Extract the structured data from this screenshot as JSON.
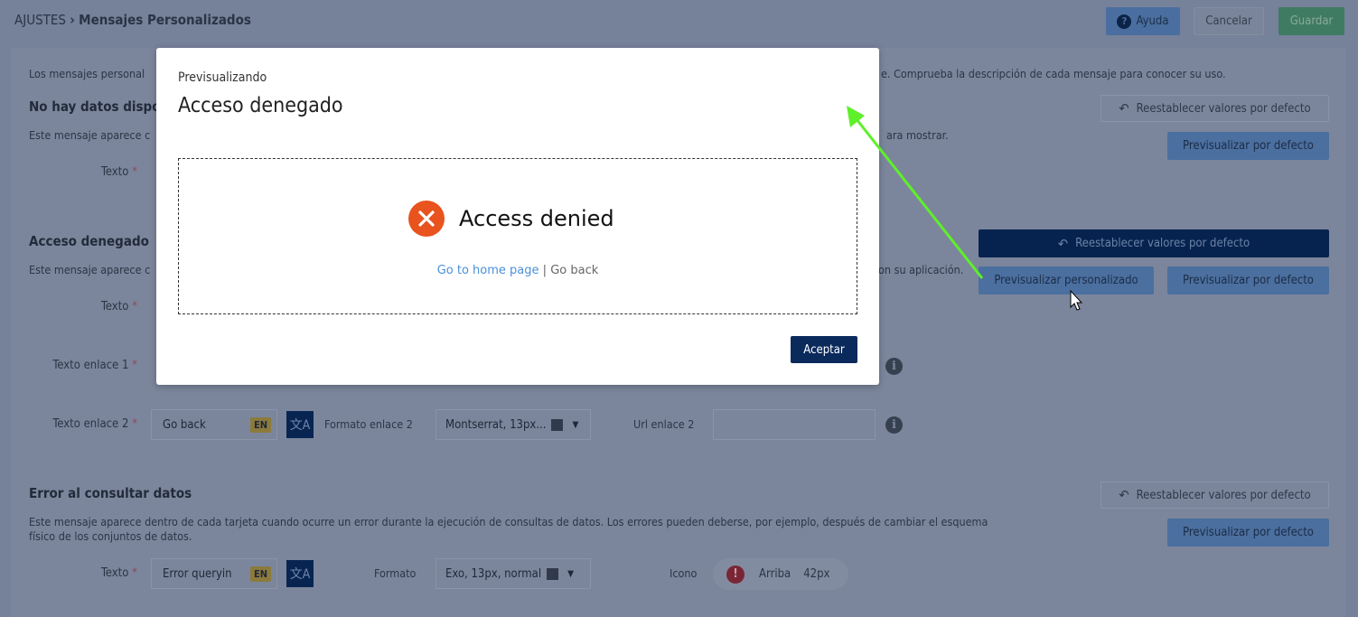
{
  "header": {
    "breadcrumb_root": "AJUSTES",
    "breadcrumb_sep": "›",
    "breadcrumb_current": "Mensajes Personalizados",
    "help": "Ayuda",
    "cancel": "Cancelar",
    "save": "Guardar"
  },
  "intro": {
    "left": "Los mensajes personal",
    "right": "e. Comprueba la descripción de cada mensaje para conocer su uso."
  },
  "common": {
    "reset": "Reestablecer valores por defecto",
    "preview_default": "Previsualizar por defecto",
    "preview_custom": "Previsualizar personalizado",
    "required": "*",
    "lang": "EN"
  },
  "no_data": {
    "title": "No hay datos dispo",
    "desc_left": "Este mensaje aparece c",
    "desc_right": "ara mostrar.",
    "text_label": "Texto"
  },
  "access": {
    "title": "Acceso denegado",
    "desc_left": "Este mensaje aparece c",
    "desc_right": "on su aplicación.",
    "text_label": "Texto",
    "link1_label": "Texto enlace 1",
    "link2_label": "Texto enlace 2",
    "link2_value": "Go back",
    "link2_format_label": "Formato enlace 2",
    "link2_format": "Montserrat, 13px...",
    "url2_label": "Url enlace 2",
    "url2_value": ""
  },
  "error": {
    "title": "Error al consultar datos",
    "desc1": "Este mensaje aparece dentro de cada tarjeta cuando ocurre un error durante la ejecución de consultas de datos. Los errores pueden deberse, por ejemplo, después de cambiar el esquema",
    "desc2": "físico de los conjuntos de datos.",
    "text_label": "Texto",
    "text_value": "Error queryin",
    "format_label": "Formato",
    "format": "Exo, 13px, normal",
    "icon_label": "Icono",
    "icon_pos": "Arriba",
    "icon_size": "42px"
  },
  "modal": {
    "subtitle": "Previsualizando",
    "title": "Acceso denegado",
    "message": "Access denied",
    "link1": "Go to home page",
    "sep": "|",
    "link2": "Go back",
    "accept": "Aceptar"
  },
  "colors": {
    "accent": "#0b2a5c",
    "error_icon": "#e8531e",
    "link": "#4a90d9",
    "annotation_arrow": "#5ef02a"
  }
}
